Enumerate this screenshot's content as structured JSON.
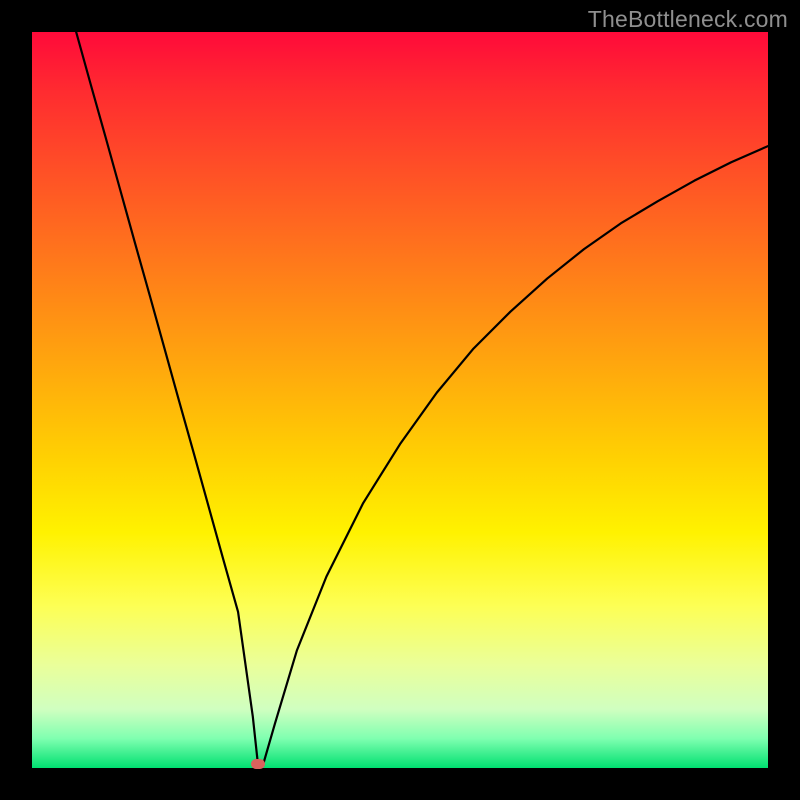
{
  "watermark": "TheBottleneck.com",
  "chart_data": {
    "type": "line",
    "title": "",
    "xlabel": "",
    "ylabel": "",
    "xlim": [
      0,
      100
    ],
    "ylim": [
      0,
      100
    ],
    "grid": false,
    "legend": false,
    "series": [
      {
        "name": "curve",
        "x": [
          6,
          8,
          10,
          12,
          14,
          16,
          18,
          20,
          22,
          24,
          26,
          28,
          30,
          30.7,
          31.5,
          33,
          36,
          40,
          45,
          50,
          55,
          60,
          65,
          70,
          75,
          80,
          85,
          90,
          95,
          100
        ],
        "y": [
          100,
          92.8,
          85.7,
          78.5,
          71.3,
          64.2,
          57.0,
          49.8,
          42.7,
          35.5,
          28.3,
          21.2,
          7.0,
          0.5,
          0.8,
          6.0,
          16.0,
          26.0,
          36.0,
          44.0,
          51.0,
          57.0,
          62.0,
          66.5,
          70.5,
          74.0,
          77.0,
          79.8,
          82.3,
          84.5
        ]
      }
    ],
    "marker": {
      "x": 30.7,
      "y": 0.6
    },
    "colors": {
      "curve": "#000000",
      "marker": "#d9625d",
      "gradient_top": "#ff0a3a",
      "gradient_mid": "#ffd102",
      "gradient_bottom": "#00e070"
    }
  }
}
